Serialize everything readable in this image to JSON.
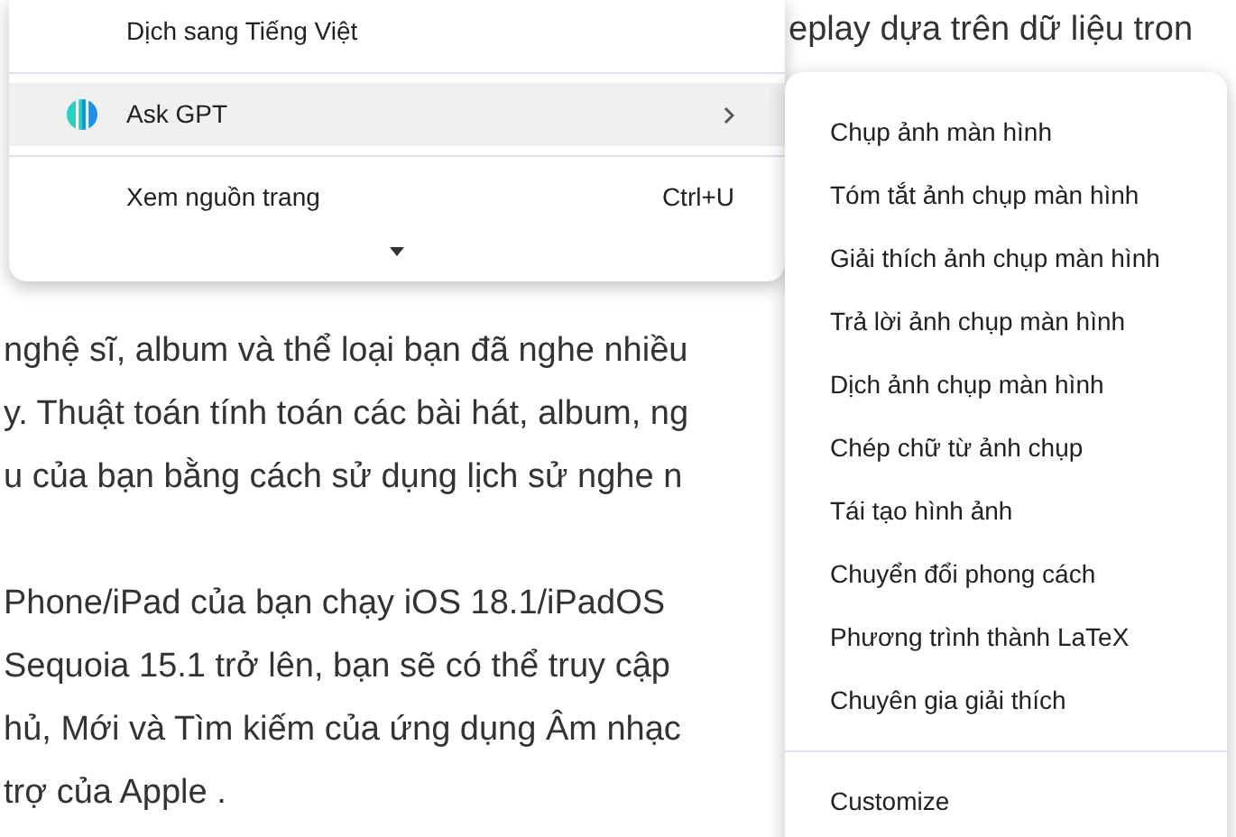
{
  "article": {
    "top_fragment": "eplay dựa trên dữ liệu tron",
    "paragraphs": [
      [
        "nghệ sĩ, album và thể loại bạn đã nghe nhiều",
        "y. Thuật toán tính toán các bài hát, album, ng",
        "u của bạn bằng cách sử dụng lịch sử nghe n"
      ],
      [
        "Phone/iPad của bạn chạy iOS 18.1/iPadOS",
        "Sequoia 15.1 trở lên, bạn sẽ có thể truy cập",
        "hủ, Mới và Tìm kiếm của ứng dụng Âm nhạc",
        "trợ của Apple ."
      ]
    ]
  },
  "context_menu": {
    "items": [
      {
        "kind": "item",
        "label": "Dịch sang Tiếng Việt",
        "selected": false
      },
      {
        "kind": "separator"
      },
      {
        "kind": "submenu",
        "label": "Ask GPT",
        "selected": true
      },
      {
        "kind": "separator"
      },
      {
        "kind": "item",
        "label": "Xem nguồn trang",
        "shortcut": "Ctrl+U",
        "selected": false
      },
      {
        "kind": "more"
      }
    ]
  },
  "submenu": {
    "items": [
      {
        "kind": "item",
        "label": "Chụp ảnh màn hình"
      },
      {
        "kind": "item",
        "label": "Tóm tắt ảnh chụp màn hình"
      },
      {
        "kind": "item",
        "label": "Giải thích ảnh chụp màn hình"
      },
      {
        "kind": "item",
        "label": "Trả lời ảnh chụp màn hình"
      },
      {
        "kind": "item",
        "label": "Dịch ảnh chụp màn hình"
      },
      {
        "kind": "item",
        "label": "Chép chữ từ ảnh chụp"
      },
      {
        "kind": "item",
        "label": "Tái tạo hình ảnh"
      },
      {
        "kind": "item",
        "label": "Chuyển đổi phong cách"
      },
      {
        "kind": "item",
        "label": "Phương trình thành LaTeX"
      },
      {
        "kind": "item",
        "label": "Chuyên gia giải thích"
      },
      {
        "kind": "separator"
      },
      {
        "kind": "item",
        "label": "Customize"
      }
    ]
  }
}
